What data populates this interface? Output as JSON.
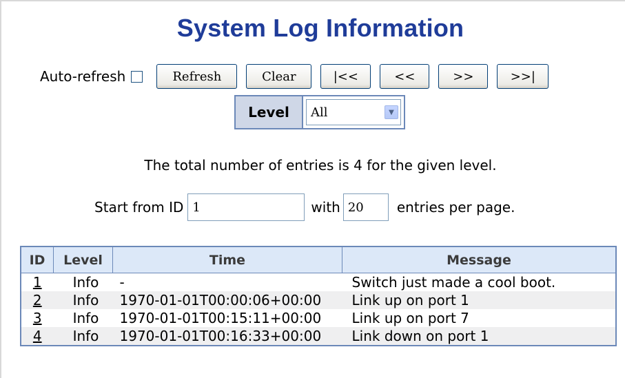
{
  "page": {
    "title": "System Log Information"
  },
  "toolbar": {
    "auto_refresh_label": "Auto-refresh",
    "auto_refresh_checked": false,
    "refresh_label": "Refresh",
    "clear_label": "Clear",
    "first_label": "|<<",
    "prev_label": "<<",
    "next_label": ">>",
    "last_label": ">>|"
  },
  "level_filter": {
    "label": "Level",
    "selected": "All"
  },
  "summary": {
    "total_text": "The total number of entries is 4 for the given level."
  },
  "paging": {
    "start_prefix": "Start from ID",
    "start_id": "1",
    "with_label": "with",
    "per_page": "20",
    "suffix": "entries per page."
  },
  "table": {
    "headers": [
      "ID",
      "Level",
      "Time",
      "Message"
    ],
    "rows": [
      {
        "id": "1",
        "level": "Info",
        "time": "-",
        "message": "Switch just made a cool boot."
      },
      {
        "id": "2",
        "level": "Info",
        "time": "1970-01-01T00:00:06+00:00",
        "message": "Link up on port 1"
      },
      {
        "id": "3",
        "level": "Info",
        "time": "1970-01-01T00:15:11+00:00",
        "message": "Link up on port 7"
      },
      {
        "id": "4",
        "level": "Info",
        "time": "1970-01-01T00:16:33+00:00",
        "message": "Link down on port 1"
      }
    ]
  },
  "colors": {
    "title": "#1f3c99",
    "table_border": "#6b88b8",
    "header_bg": "#dce8f8",
    "alt_row_bg": "#efeff0"
  }
}
